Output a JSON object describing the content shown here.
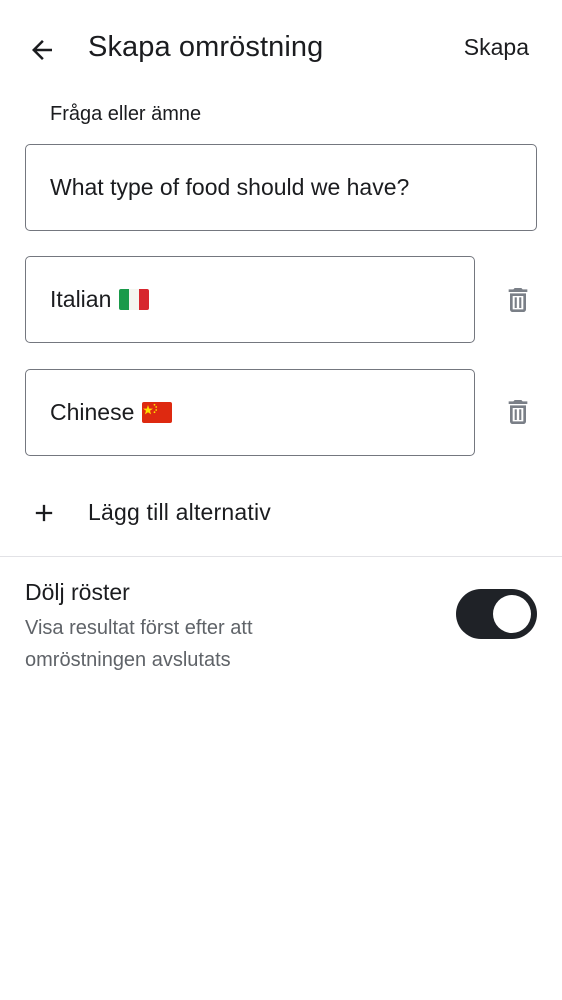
{
  "header": {
    "title": "Skapa omröstning",
    "create_label": "Skapa",
    "back_icon": "arrow-left-icon"
  },
  "question": {
    "label": "Fråga eller ämne",
    "value": "What type of food should we have?"
  },
  "options": [
    {
      "text": "Italian",
      "flag": "italy-flag"
    },
    {
      "text": "Chinese",
      "flag": "china-flag"
    }
  ],
  "add_option": {
    "label": "Lägg till alternativ",
    "icon": "plus-icon"
  },
  "hide_votes": {
    "title": "Dölj röster",
    "description": "Visa resultat först efter att omröstningen avslutats",
    "enabled": true
  },
  "colors": {
    "toggle_on": "#1f2227",
    "field_border": "#74777f",
    "secondary_text": "#5f6368",
    "icon_grey": "#7a7f87"
  }
}
